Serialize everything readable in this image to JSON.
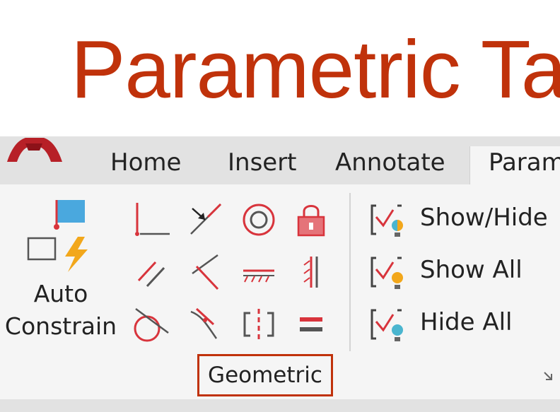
{
  "slide": {
    "title": "Parametric Ta"
  },
  "tabs": [
    {
      "label": "Home"
    },
    {
      "label": "Insert"
    },
    {
      "label": "Annotate"
    },
    {
      "label": "Param",
      "active": true
    }
  ],
  "ribbon": {
    "auto_constrain": {
      "line1": "Auto",
      "line2": "Constrain"
    },
    "geometric_tools": [
      "coincident-icon",
      "collinear-icon",
      "concentric-icon",
      "fix-icon",
      "parallel-icon",
      "perpendicular-icon",
      "horizontal-icon",
      "vertical-icon",
      "tangent-icon",
      "smooth-icon",
      "symmetric-icon",
      "equal-icon"
    ],
    "panel_label": "Geometric",
    "visibility": {
      "show_hide": "Show/Hide",
      "show_all": "Show All",
      "hide_all": "Hide All"
    }
  },
  "colors": {
    "accent": "#c0320b",
    "icon_red": "#d8343c",
    "icon_blue": "#4aa8de",
    "bolt_orange": "#f2a71b"
  }
}
